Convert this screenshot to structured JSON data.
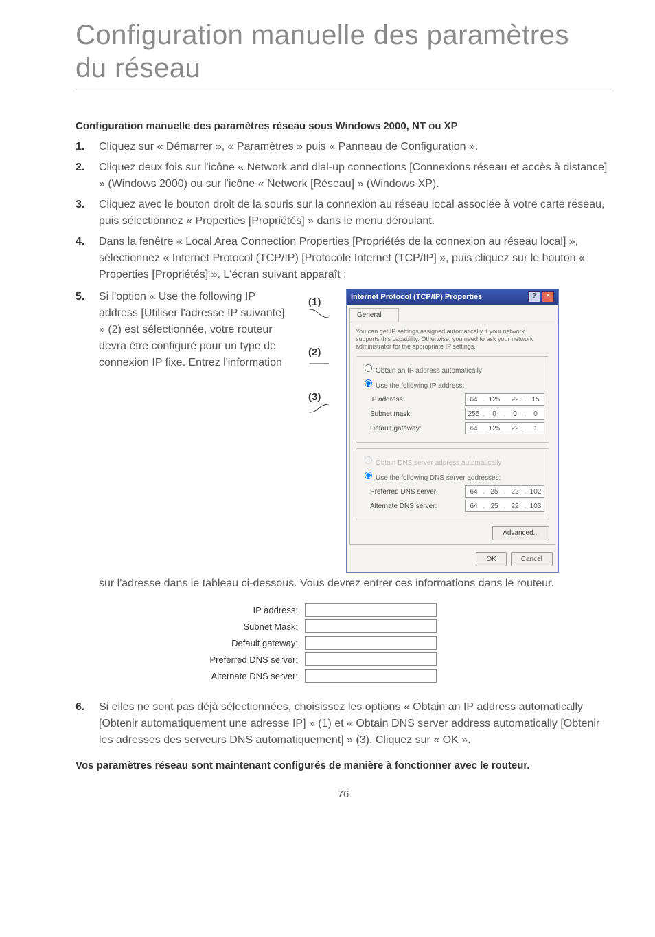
{
  "title_line1": "Configuration manuelle des paramètres",
  "title_line2": "du réseau",
  "subheading": "Configuration manuelle des paramètres réseau sous Windows 2000, NT ou XP",
  "steps_a": [
    {
      "num": "1.",
      "text": "Cliquez sur « Démarrer », « Paramètres » puis « Panneau de Configuration »."
    },
    {
      "num": "2.",
      "text": "Cliquez deux fois sur l'icône « Network and dial-up connections [Connexions réseau et accès à distance] » (Windows 2000) ou sur l'icône « Network [Réseau] » (Windows XP)."
    },
    {
      "num": "3.",
      "text": "Cliquez avec le bouton droit de la souris sur la connexion au réseau local associée à votre carte réseau, puis sélectionnez « Properties [Propriétés] » dans le menu déroulant."
    },
    {
      "num": "4.",
      "text": "Dans la fenêtre « Local Area Connection Properties [Propriétés de la connexion au réseau local] », sélectionnez « Internet Protocol (TCP/IP) [Protocole Internet (TCP/IP] », puis cliquez sur le bouton « Properties [Propriétés] ». L'écran suivant apparaît :"
    }
  ],
  "callouts": {
    "c1": "(1)",
    "c2": "(2)",
    "c3": "(3)"
  },
  "step5": {
    "num": "5.",
    "text_left": "Si l'option « Use the following IP address [Utiliser l'adresse IP suivante] »  (2) est sélectionnée, votre routeur devra être configuré pour un type de connexion IP fixe. Entrez l'information",
    "text_after": "sur l'adresse dans le tableau ci-dessous. Vous devrez entrer ces informations dans le routeur."
  },
  "tcpip": {
    "title": "Internet Protocol (TCP/IP) Properties",
    "tab": "General",
    "note": "You can get IP settings assigned automatically if your network supports this capability. Otherwise, you need to ask your network administrator for the appropriate IP settings.",
    "r_obtain_ip": "Obtain an IP address automatically",
    "r_use_ip": "Use the following IP address:",
    "l_ip": "IP address:",
    "l_mask": "Subnet mask:",
    "l_gw": "Default gateway:",
    "r_obtain_dns": "Obtain DNS server address automatically",
    "r_use_dns": "Use the following DNS server addresses:",
    "l_pdns": "Preferred DNS server:",
    "l_adns": "Alternate DNS server:",
    "btn_adv": "Advanced...",
    "btn_ok": "OK",
    "btn_cancel": "Cancel",
    "ip": [
      "64",
      "125",
      "22",
      "15"
    ],
    "mask": [
      "255",
      "0",
      "0",
      "0"
    ],
    "gw": [
      "64",
      "125",
      "22",
      "1"
    ],
    "pdns": [
      "64",
      "25",
      "22",
      "102"
    ],
    "adns": [
      "64",
      "25",
      "22",
      "103"
    ]
  },
  "mini": [
    "IP address:",
    "Subnet Mask:",
    "Default gateway:",
    "Preferred DNS server:",
    "Alternate DNS server:"
  ],
  "step6": {
    "num": "6.",
    "text": "Si elles ne sont pas déjà sélectionnées, choisissez les options « Obtain an IP address automatically [Obtenir automatiquement une adresse IP] »  (1)  et « Obtain DNS server address automatically [Obtenir les adresses des serveurs DNS automatiquement] » (3). Cliquez sur « OK »."
  },
  "closing": "Vos paramètres réseau sont maintenant configurés de manière à fonctionner avec le routeur.",
  "pagenum": "76"
}
